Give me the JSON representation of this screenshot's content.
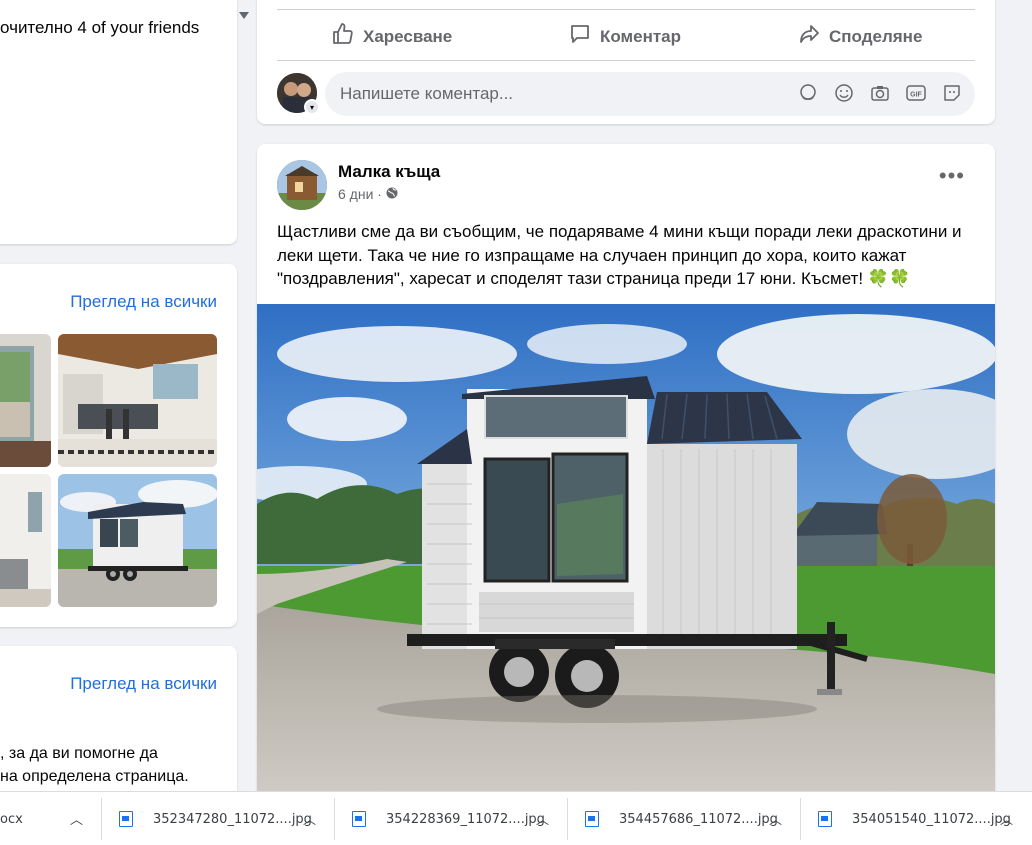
{
  "left": {
    "friends_text": "очително 4 of your friends",
    "view_all_1": "Преглед на всички",
    "view_all_2": "Преглед на всички",
    "help_line_1": ", за да ви помогне да",
    "help_line_2": "на определена страница."
  },
  "top_post": {
    "like_label": "Харесване",
    "comment_label": "Коментар",
    "share_label": "Споделяне",
    "comment_placeholder": "Напишете коментар...",
    "gif_label": "GIF"
  },
  "main_post": {
    "page_name": "Малка къща",
    "time": "6 дни ·",
    "text": "Щастливи сме да ви съобщим, че подаряваме 4 мини къщи поради леки драскотини и леки щети. Така че ние го изпращаме на случаен принцип до хора, които кажат \"поздравления\", харесат и споделят тази страница преди 17 юни. Късмет! 🍀🍀"
  },
  "downloads": {
    "items": [
      {
        "name": "осх"
      },
      {
        "name": "352347280_11072....jpg"
      },
      {
        "name": "354228369_11072....jpg"
      },
      {
        "name": "354457686_11072....jpg"
      },
      {
        "name": "354051540_11072....jpg"
      }
    ]
  },
  "colors": {
    "link": "#216fdb",
    "muted": "#65676b",
    "background": "#f0f2f5",
    "download_icon": "#1a73e8"
  }
}
